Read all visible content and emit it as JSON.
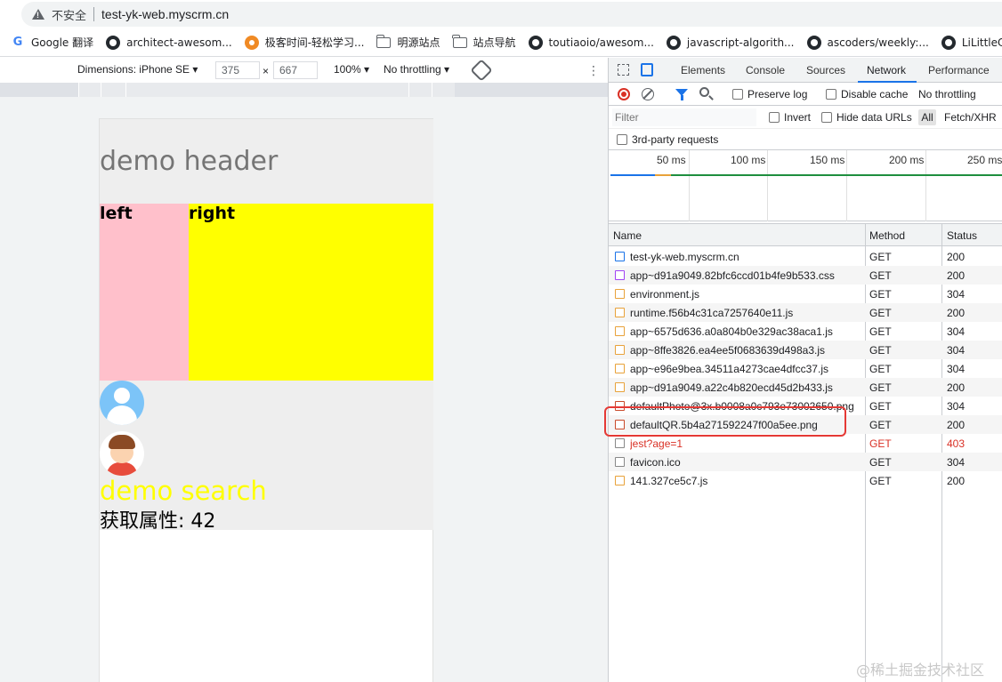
{
  "addressbar": {
    "security": "不安全",
    "url": "test-yk-web.myscrm.cn"
  },
  "bookmarks": [
    {
      "label": "Google 翻译",
      "icon": "google-translate-icon"
    },
    {
      "label": "architect-awesom...",
      "icon": "github-icon"
    },
    {
      "label": "极客时间-轻松学习...",
      "icon": "geektime-icon"
    },
    {
      "label": "明源站点",
      "icon": "folder-icon"
    },
    {
      "label": "站点导航",
      "icon": "folder-icon"
    },
    {
      "label": "toutiaoio/awesom...",
      "icon": "github-icon"
    },
    {
      "label": "javascript-algorith...",
      "icon": "github-icon"
    },
    {
      "label": "ascoders/weekly:...",
      "icon": "github-icon"
    },
    {
      "label": "LiLittleC",
      "icon": "github-icon"
    }
  ],
  "device_toolbar": {
    "dimensions_label": "Dimensions: iPhone SE ▾",
    "width": "375",
    "times": "×",
    "height": "667",
    "zoom": "100% ▾",
    "throttling": "No throttling ▾"
  },
  "page": {
    "header": "demo header",
    "left": "left",
    "right": "right",
    "search": "demo search",
    "property": "获取属性: 42"
  },
  "devtools": {
    "tabs": [
      "Elements",
      "Console",
      "Sources",
      "Network",
      "Performance"
    ],
    "active_tab": "Network",
    "toolbar": {
      "preserve_log": "Preserve log",
      "disable_cache": "Disable cache",
      "throttling": "No throttling"
    },
    "filter": {
      "placeholder": "Filter",
      "invert": "Invert",
      "hide_data_urls": "Hide data URLs",
      "all": "All",
      "fetch_xhr": "Fetch/XHR",
      "third_party": "3rd-party requests"
    },
    "timeline_labels": [
      "50 ms",
      "100 ms",
      "150 ms",
      "200 ms",
      "250 ms"
    ],
    "columns": {
      "name": "Name",
      "method": "Method",
      "status": "Status"
    },
    "requests": [
      {
        "name": "test-yk-web.myscrm.cn",
        "method": "GET",
        "status": "200",
        "type": "doc"
      },
      {
        "name": "app~d91a9049.82bfc6ccd01b4fe9b533.css",
        "method": "GET",
        "status": "200",
        "type": "css"
      },
      {
        "name": "environment.js",
        "method": "GET",
        "status": "304",
        "type": "js"
      },
      {
        "name": "runtime.f56b4c31ca7257640e11.js",
        "method": "GET",
        "status": "200",
        "type": "js"
      },
      {
        "name": "app~6575d636.a0a804b0e329ac38aca1.js",
        "method": "GET",
        "status": "304",
        "type": "js"
      },
      {
        "name": "app~8ffe3826.ea4ee5f0683639d498a3.js",
        "method": "GET",
        "status": "304",
        "type": "js"
      },
      {
        "name": "app~e96e9bea.34511a4273cae4dfcc37.js",
        "method": "GET",
        "status": "304",
        "type": "js"
      },
      {
        "name": "app~d91a9049.a22c4b820ecd45d2b433.js",
        "method": "GET",
        "status": "200",
        "type": "js"
      },
      {
        "name": "defaultPhoto@3x.b0008a0c793e73002650.png",
        "method": "GET",
        "status": "304",
        "type": "img"
      },
      {
        "name": "defaultQR.5b4a271592247f00a5ee.png",
        "method": "GET",
        "status": "200",
        "type": "img"
      },
      {
        "name": "jest?age=1",
        "method": "GET",
        "status": "403",
        "type": "other",
        "error": true
      },
      {
        "name": "favicon.ico",
        "method": "GET",
        "status": "304",
        "type": "other"
      },
      {
        "name": "141.327ce5c7.js",
        "method": "GET",
        "status": "200",
        "type": "js"
      }
    ]
  },
  "watermark": "@稀土掘金技术社区"
}
